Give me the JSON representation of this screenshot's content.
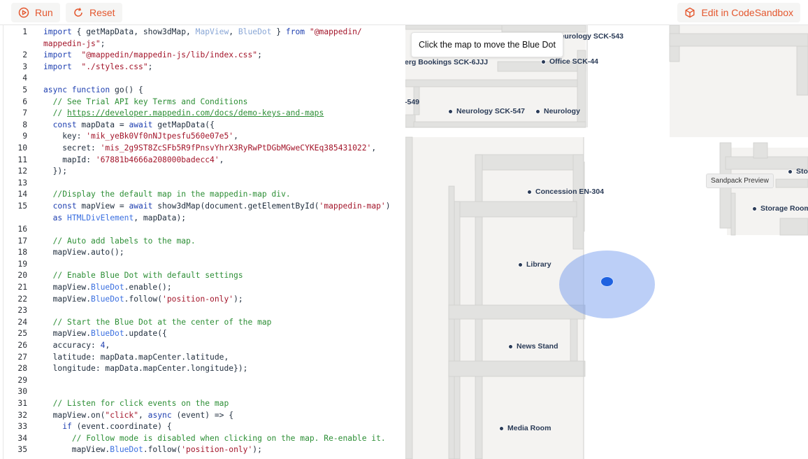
{
  "toolbar": {
    "run_label": "Run",
    "reset_label": "Reset",
    "sandbox_label": "Edit in CodeSandbox",
    "accent_color": "#e4572e"
  },
  "editor": {
    "lines": [
      {
        "n": "1",
        "segs": [
          [
            "kw",
            "import"
          ],
          [
            "",
            "{ getMapData, show3dMap, "
          ],
          [
            "dim",
            "MapView"
          ],
          [
            "",
            ", "
          ],
          [
            "dim",
            "BlueDot"
          ],
          [
            "",
            " } "
          ],
          [
            "kw",
            "from"
          ],
          [
            "",
            " "
          ],
          [
            "str",
            "\"@mappedin/"
          ]
        ]
      },
      {
        "n": "",
        "segs": [
          [
            "str",
            "mappedin-js\""
          ],
          [
            "",
            ";"
          ]
        ]
      },
      {
        "n": "2",
        "segs": [
          [
            "kw",
            "import"
          ],
          [
            "",
            " "
          ],
          [
            "str",
            "\"@mappedin/mappedin-js/lib/index.css\""
          ],
          [
            "",
            ";"
          ]
        ]
      },
      {
        "n": "3",
        "segs": [
          [
            "kw",
            "import"
          ],
          [
            "",
            " "
          ],
          [
            "str",
            "\"./styles.css\""
          ],
          [
            "",
            ";"
          ]
        ]
      },
      {
        "n": "4",
        "segs": []
      },
      {
        "n": "5",
        "segs": [
          [
            "kw",
            "async function"
          ],
          [
            "",
            " go() {"
          ]
        ]
      },
      {
        "n": "6",
        "segs": [
          [
            "",
            "  "
          ],
          [
            "cm",
            "// See Trial API key Terms and Conditions"
          ]
        ]
      },
      {
        "n": "7",
        "segs": [
          [
            "",
            "  "
          ],
          [
            "cm",
            "// "
          ],
          [
            "url",
            "https://developer.mappedin.com/docs/demo-keys-and-maps"
          ]
        ]
      },
      {
        "n": "8",
        "segs": [
          [
            "",
            "  "
          ],
          [
            "kw",
            "const"
          ],
          [
            "",
            " mapData = "
          ],
          [
            "kw",
            "await"
          ],
          [
            "",
            " getMapData({"
          ]
        ]
      },
      {
        "n": "9",
        "segs": [
          [
            "",
            "    key: "
          ],
          [
            "str",
            "'mik_yeBk0Vf0nNJtpesfu560e07e5'"
          ],
          [
            "",
            ","
          ]
        ]
      },
      {
        "n": "10",
        "segs": [
          [
            "",
            "    secret: "
          ],
          [
            "str",
            "'mis_2g9ST8ZcSFb5R9fPnsvYhrX3RyRwPtDGbMGweCYKEq385431022'"
          ],
          [
            "",
            ","
          ]
        ]
      },
      {
        "n": "11",
        "segs": [
          [
            "",
            "    mapId: "
          ],
          [
            "str",
            "'67881b4666a208000badecc4'"
          ],
          [
            "",
            ","
          ]
        ]
      },
      {
        "n": "12",
        "segs": [
          [
            "",
            "  });"
          ]
        ]
      },
      {
        "n": "13",
        "segs": []
      },
      {
        "n": "14",
        "segs": [
          [
            "",
            "  "
          ],
          [
            "cm",
            "//Display the default map in the mappedin-map div."
          ]
        ]
      },
      {
        "n": "15",
        "segs": [
          [
            "",
            "  "
          ],
          [
            "kw",
            "const"
          ],
          [
            "",
            " mapView = "
          ],
          [
            "kw",
            "await"
          ],
          [
            "",
            " show3dMap(document.getElementById("
          ],
          [
            "str",
            "'mappedin-map'"
          ],
          [
            "",
            ")"
          ]
        ]
      },
      {
        "n": "",
        "segs": [
          [
            "",
            "  "
          ],
          [
            "kw",
            "as"
          ],
          [
            "",
            " "
          ],
          [
            "ty",
            "HTMLDivElement"
          ],
          [
            "",
            ", mapData);"
          ]
        ]
      },
      {
        "n": "16",
        "segs": []
      },
      {
        "n": "17",
        "segs": [
          [
            "",
            "  "
          ],
          [
            "cm",
            "// Auto add labels to the map."
          ]
        ]
      },
      {
        "n": "18",
        "segs": [
          [
            "",
            "  mapView.auto();"
          ]
        ]
      },
      {
        "n": "19",
        "segs": []
      },
      {
        "n": "20",
        "segs": [
          [
            "",
            "  "
          ],
          [
            "cm",
            "// Enable Blue Dot with default settings"
          ]
        ]
      },
      {
        "n": "21",
        "segs": [
          [
            "",
            "  mapView."
          ],
          [
            "ty",
            "BlueDot"
          ],
          [
            "",
            ".enable();"
          ]
        ]
      },
      {
        "n": "22",
        "segs": [
          [
            "",
            "  mapView."
          ],
          [
            "ty",
            "BlueDot"
          ],
          [
            "",
            ".follow("
          ],
          [
            "str",
            "'position-only'"
          ],
          [
            "",
            ");"
          ]
        ]
      },
      {
        "n": "23",
        "segs": []
      },
      {
        "n": "24",
        "segs": [
          [
            "",
            "  "
          ],
          [
            "cm",
            "// Start the Blue Dot at the center of the map"
          ]
        ]
      },
      {
        "n": "25",
        "segs": [
          [
            "",
            "  mapView."
          ],
          [
            "ty",
            "BlueDot"
          ],
          [
            "",
            ".update({"
          ]
        ]
      },
      {
        "n": "26",
        "segs": [
          [
            "",
            "  accuracy: "
          ],
          [
            "kw",
            "4"
          ],
          [
            "",
            ","
          ]
        ]
      },
      {
        "n": "27",
        "segs": [
          [
            "",
            "  latitude: mapData.mapCenter.latitude,"
          ]
        ]
      },
      {
        "n": "28",
        "segs": [
          [
            "",
            "  longitude: mapData.mapCenter.longitude});"
          ]
        ]
      },
      {
        "n": "29",
        "segs": []
      },
      {
        "n": "30",
        "segs": []
      },
      {
        "n": "31",
        "segs": [
          [
            "",
            "  "
          ],
          [
            "cm",
            "// Listen for click events on the map"
          ]
        ]
      },
      {
        "n": "32",
        "segs": [
          [
            "",
            "  mapView.on("
          ],
          [
            "str",
            "\"click\""
          ],
          [
            "",
            ", "
          ],
          [
            "kw",
            "async"
          ],
          [
            "",
            " (event) => {"
          ]
        ]
      },
      {
        "n": "33",
        "segs": [
          [
            "",
            "    "
          ],
          [
            "kw",
            "if"
          ],
          [
            "",
            " (event.coordinate) {"
          ]
        ]
      },
      {
        "n": "34",
        "segs": [
          [
            "",
            "      "
          ],
          [
            "cm",
            "// Follow mode is disabled when clicking on the map. Re-enable it."
          ]
        ]
      },
      {
        "n": "35",
        "segs": [
          [
            "",
            "      mapView."
          ],
          [
            "ty",
            "BlueDot"
          ],
          [
            "",
            ".follow("
          ],
          [
            "str",
            "'position-only'"
          ],
          [
            "",
            ");"
          ]
        ]
      }
    ]
  },
  "map": {
    "tooltip": "Click the map to move the Blue Dot",
    "preview_badge": "Sandpack Preview",
    "pois": [
      {
        "id": "neurology-sck-543",
        "label": "Neurology SCK-543"
      },
      {
        "id": "office-sck-44",
        "label": "Office SCK-44"
      },
      {
        "id": "berg-bookings",
        "label": "erg Bookings SCK-6JJJ"
      },
      {
        "id": "sck-549",
        "label": "-549"
      },
      {
        "id": "neurology-sck-547",
        "label": "Neurology SCK-547"
      },
      {
        "id": "neurology",
        "label": "Neurology"
      },
      {
        "id": "concession",
        "label": "Concession EN-304"
      },
      {
        "id": "sto",
        "label": "Sto"
      },
      {
        "id": "storage-room",
        "label": "Storage Room"
      },
      {
        "id": "library",
        "label": "Library"
      },
      {
        "id": "news-stand",
        "label": "News Stand"
      },
      {
        "id": "media-room",
        "label": "Media Room"
      }
    ],
    "floor_color": "#f4f3f1",
    "wall_color": "#dcdcda",
    "bluedot_color": "#1f62e0"
  }
}
